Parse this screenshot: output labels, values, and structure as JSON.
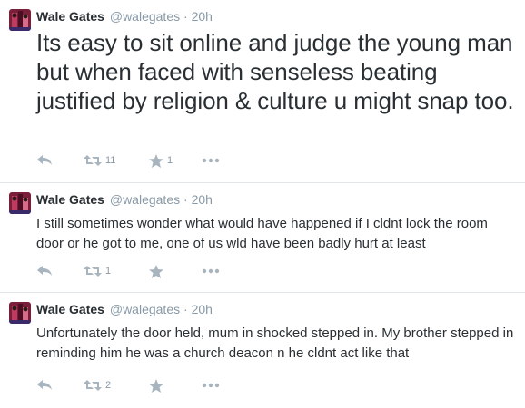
{
  "colors": {
    "text": "#292f33",
    "muted": "#8899a6",
    "icon": "#a8b5bf",
    "divider": "#e1e8ed"
  },
  "tweets": [
    {
      "name": "Wale Gates",
      "handle": "@walegates",
      "separator": "·",
      "time": "20h",
      "text": "Its easy to sit online and judge the young man but when faced with senseless beating justified by religion & culture u might snap too.",
      "retweets": "11",
      "favorites": "1",
      "icons": [
        "reply-icon",
        "retweet-icon",
        "favorite-icon",
        "more-icon"
      ]
    },
    {
      "name": "Wale Gates",
      "handle": "@walegates",
      "separator": "·",
      "time": "20h",
      "text": "I still sometimes wonder what would have happened if I cldnt lock the room door or he got to me, one of us wld have been badly hurt at least",
      "retweets": "1",
      "favorites": "",
      "icons": [
        "reply-icon",
        "retweet-icon",
        "favorite-icon",
        "more-icon"
      ]
    },
    {
      "name": "Wale Gates",
      "handle": "@walegates",
      "separator": "·",
      "time": "20h",
      "text": "Unfortunately the door held, mum in shocked stepped in. My brother stepped in reminding him he was a church deacon n he cldnt act like that",
      "retweets": "2",
      "favorites": "",
      "icons": [
        "reply-icon",
        "retweet-icon",
        "favorite-icon",
        "more-icon"
      ]
    }
  ]
}
